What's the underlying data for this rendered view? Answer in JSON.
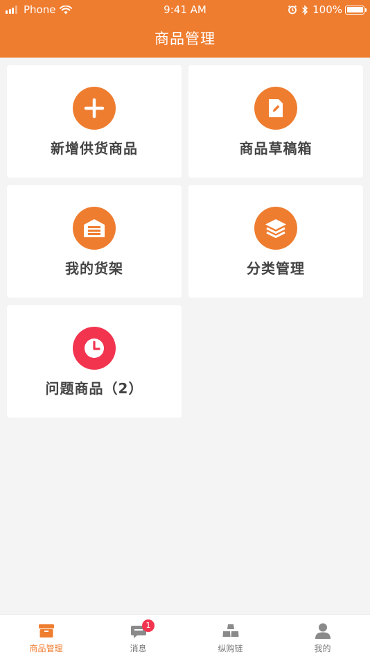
{
  "status_bar": {
    "carrier": "Phone",
    "time": "9:41 AM",
    "battery": "100%"
  },
  "header": {
    "title": "商品管理"
  },
  "cards": [
    {
      "label": "新增供货商品",
      "icon": "plus-icon",
      "color": "#ef7d30"
    },
    {
      "label": "商品草稿箱",
      "icon": "draft-edit-icon",
      "color": "#ef7d30"
    },
    {
      "label": "我的货架",
      "icon": "shelf-warehouse-icon",
      "color": "#ef7d30"
    },
    {
      "label": "分类管理",
      "icon": "layers-icon",
      "color": "#ef7d30"
    },
    {
      "label": "问题商品（2）",
      "icon": "clock-icon",
      "color": "#f2344f"
    }
  ],
  "tabbar": {
    "items": [
      {
        "label": "商品管理",
        "icon": "box-icon",
        "active": true
      },
      {
        "label": "消息",
        "icon": "message-icon",
        "badge": "1"
      },
      {
        "label": "纵购链",
        "icon": "stack-bars-icon"
      },
      {
        "label": "我的",
        "icon": "user-icon"
      }
    ]
  },
  "colors": {
    "accent": "#ef7d30",
    "alert": "#f2344f",
    "background": "#f4f4f4"
  }
}
